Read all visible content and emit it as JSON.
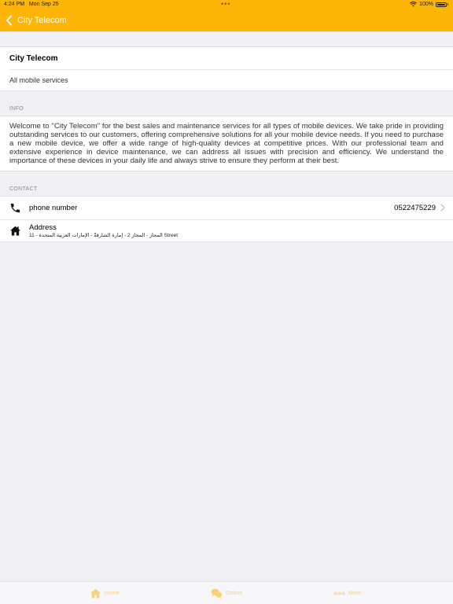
{
  "status_bar": {
    "time": "4:24 PM",
    "date": "Mon Sep 25",
    "battery": "100%"
  },
  "nav": {
    "back_title": "City Telecom"
  },
  "store": {
    "name": "City Telecom",
    "subtitle": "All mobile services"
  },
  "info": {
    "section_label": "INFO",
    "text": "Welcome to \"City Telecom\" for the best sales and maintenance services for all types of mobile devices. We take pride in providing outstanding services to our customers, offering comprehensive solutions for all your mobile device needs. If you need to purchase a new mobile device, we offer a wide range of high-quality devices at competitive prices. With our professional team and extensive experience in device maintenance, we can address all issues with precision and efficiency. We understand the importance of these devices in your daily life and always strive to ensure they perform at their best."
  },
  "contact": {
    "section_label": "CONTACT",
    "phone_label": "phone number",
    "phone_value": "0522475229",
    "address_label": "Address",
    "address_value": "المجاز - المجاز 2 - إمارة الشارقةّ - الإمارات العربية المتحدة - 11 Street"
  },
  "tabs": [
    {
      "label": "Home",
      "icon": "home-icon"
    },
    {
      "label": "Orders",
      "icon": "chat-bubbles-icon"
    },
    {
      "label": "More",
      "icon": "more-dots-icon"
    }
  ],
  "colors": {
    "accent": "#fdb508",
    "background": "#efeff4"
  }
}
